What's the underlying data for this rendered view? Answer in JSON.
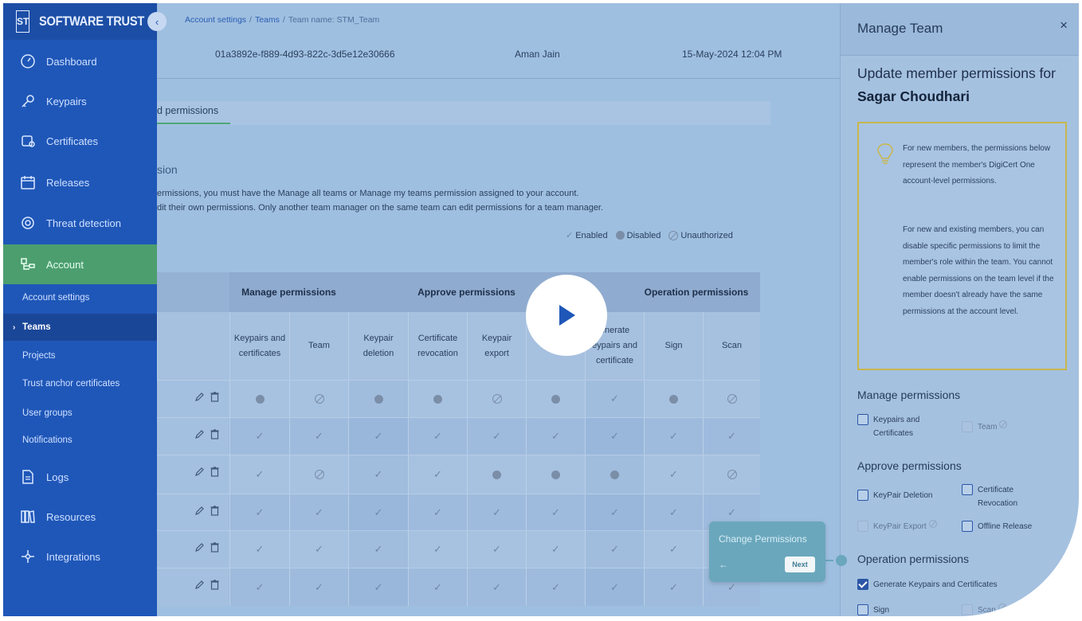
{
  "brand": {
    "logo": "ST",
    "name": "SOFTWARE TRUST"
  },
  "sidebar": {
    "items": [
      {
        "label": "Dashboard",
        "icon": "dashboard-icon"
      },
      {
        "label": "Keypairs",
        "icon": "key-icon"
      },
      {
        "label": "Certificates",
        "icon": "certificate-icon"
      },
      {
        "label": "Releases",
        "icon": "calendar-icon"
      },
      {
        "label": "Threat detection",
        "icon": "threat-icon"
      },
      {
        "label": "Account",
        "icon": "account-icon"
      }
    ],
    "sub_items": [
      {
        "label": "Account settings"
      },
      {
        "label": "Teams"
      },
      {
        "label": "Projects"
      },
      {
        "label": "Trust anchor certificates"
      },
      {
        "label": "User groups"
      },
      {
        "label": "Notifications"
      }
    ],
    "bottom_items": [
      {
        "label": "Logs",
        "icon": "logs-icon"
      },
      {
        "label": "Resources",
        "icon": "resources-icon"
      },
      {
        "label": "Integrations",
        "icon": "integrations-icon"
      }
    ]
  },
  "breadcrumb": {
    "first": "Account settings",
    "second": "Teams",
    "current": "Team name: STM_Team"
  },
  "team_info": {
    "id": "01a3892e-f889-4d93-822c-3d5e12e30666",
    "owner": "Aman Jain",
    "date": "15-May-2024 12:04 PM"
  },
  "tab": {
    "label": "d permissions"
  },
  "section": {
    "title": "sion",
    "line1": "ermissions, you must have the Manage all teams or Manage my teams permission assigned to your account.",
    "line2": "dit their own permissions. Only another team manager on the same team can edit permissions for a team manager."
  },
  "legend": {
    "enabled": "Enabled",
    "disabled": "Disabled",
    "unauthorized": "Unauthorized"
  },
  "table": {
    "groups": [
      "Manage permissions",
      "Approve permissions",
      "Operation permissions"
    ],
    "columns": [
      "Keypairs and certificates",
      "Team",
      "Keypair deletion",
      "Certificate revocation",
      "Keypair export",
      "rele",
      "enerate eypairs and certificate",
      "Sign",
      "Scan"
    ],
    "rows": [
      [
        "disabled",
        "unauthorized",
        "disabled",
        "disabled",
        "unauthorized",
        "disabled",
        "enabled",
        "disabled",
        "unauthorized"
      ],
      [
        "enabled",
        "enabled",
        "enabled",
        "enabled",
        "enabled",
        "enabled",
        "enabled",
        "enabled",
        "enabled"
      ],
      [
        "enabled",
        "unauthorized",
        "enabled",
        "enabled",
        "disabled",
        "disabled",
        "disabled",
        "enabled",
        "unauthorized"
      ],
      [
        "enabled",
        "enabled",
        "enabled",
        "enabled",
        "enabled",
        "enabled",
        "enabled",
        "enabled",
        "enabled"
      ],
      [
        "enabled",
        "enabled",
        "enabled",
        "enabled",
        "enabled",
        "enabled",
        "enabled",
        "enabled",
        "enabled"
      ],
      [
        "enabled",
        "enabled",
        "enabled",
        "enabled",
        "enabled",
        "enabled",
        "enabled",
        "enabled",
        "enabled"
      ]
    ]
  },
  "popup": {
    "title": "Change Permissions",
    "back": "←",
    "next": "Next"
  },
  "panel": {
    "title": "Manage Team",
    "close": "×",
    "subtitle_prefix": "Update member permissions for",
    "member": "Sagar Choudhari",
    "note_p1": "For new members, the permissions below represent the member's DigiCert One account-level permissions.",
    "note_p2": "For new and existing members, you can disable specific permissions to limit the member's role within the team. You cannot enable permissions on the team level if the member doesn't already have the same permissions at the account level.",
    "manage_title": "Manage permissions",
    "manage_items": [
      {
        "label": "Keypairs and Certificates",
        "state": "unchecked"
      },
      {
        "label": "Team",
        "state": "disabled"
      }
    ],
    "approve_title": "Approve permissions",
    "approve_items": [
      {
        "label": "KeyPair Deletion",
        "state": "unchecked"
      },
      {
        "label": "Certificate Revocation",
        "state": "unchecked"
      },
      {
        "label": "KeyPair Export",
        "state": "disabled"
      },
      {
        "label": "Offline Release",
        "state": "unchecked"
      }
    ],
    "operation_title": "Operation permissions",
    "operation_items": [
      {
        "label": "Generate Keypairs and Certificates",
        "state": "checked"
      },
      {
        "label": "Sign",
        "state": "unchecked"
      },
      {
        "label": "Scan",
        "state": "disabled"
      }
    ]
  },
  "colors": {
    "sidebar": "#1f57b8",
    "active_nav": "#4c9e6f",
    "accent": "#2b56a6",
    "note_border": "#c9b64b",
    "popup": "#6aa7bd"
  }
}
